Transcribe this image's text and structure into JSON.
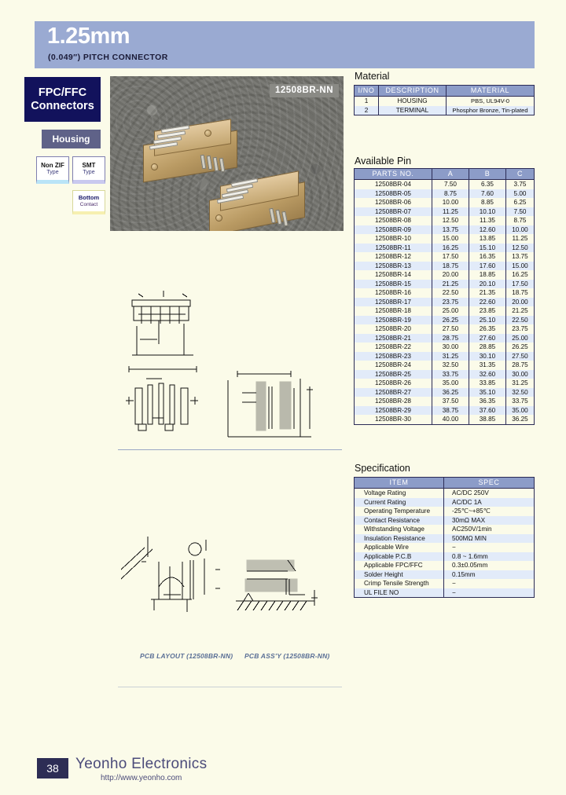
{
  "header": {
    "title": "1.25mm",
    "subtitle": "(0.049″)  PITCH  CONNECTOR"
  },
  "sidebar": {
    "family_line1": "FPC/FFC",
    "family_line2": "Connectors",
    "housing": "Housing",
    "type_nonzif_line1": "Non ZIF",
    "type_nonzif_line2": "Type",
    "type_smt_line1": "SMT",
    "type_smt_line2": "Type",
    "bottom_line1": "Bottom",
    "bottom_line2": "Contact"
  },
  "photo": {
    "label": "12508BR-NN"
  },
  "material": {
    "title": "Material",
    "columns": [
      "I/NO",
      "DESCRIPTION",
      "MATERIAL"
    ],
    "rows": [
      [
        "1",
        "HOUSING",
        "PBS, UL94V-0"
      ],
      [
        "2",
        "TERMINAL",
        "Phosphor Bronze, Tin-plated"
      ]
    ]
  },
  "available_pin": {
    "title": "Available Pin",
    "columns": [
      "PARTS NO.",
      "A",
      "B",
      "C"
    ],
    "rows": [
      [
        "12508BR-04",
        "7.50",
        "6.35",
        "3.75"
      ],
      [
        "12508BR-05",
        "8.75",
        "7.60",
        "5.00"
      ],
      [
        "12508BR-06",
        "10.00",
        "8.85",
        "6.25"
      ],
      [
        "12508BR-07",
        "11.25",
        "10.10",
        "7.50"
      ],
      [
        "12508BR-08",
        "12.50",
        "11.35",
        "8.75"
      ],
      [
        "12508BR-09",
        "13.75",
        "12.60",
        "10.00"
      ],
      [
        "12508BR-10",
        "15.00",
        "13.85",
        "11.25"
      ],
      [
        "12508BR-11",
        "16.25",
        "15.10",
        "12.50"
      ],
      [
        "12508BR-12",
        "17.50",
        "16.35",
        "13.75"
      ],
      [
        "12508BR-13",
        "18.75",
        "17.60",
        "15.00"
      ],
      [
        "12508BR-14",
        "20.00",
        "18.85",
        "16.25"
      ],
      [
        "12508BR-15",
        "21.25",
        "20.10",
        "17.50"
      ],
      [
        "12508BR-16",
        "22.50",
        "21.35",
        "18.75"
      ],
      [
        "12508BR-17",
        "23.75",
        "22.60",
        "20.00"
      ],
      [
        "12508BR-18",
        "25.00",
        "23.85",
        "21.25"
      ],
      [
        "12508BR-19",
        "26.25",
        "25.10",
        "22.50"
      ],
      [
        "12508BR-20",
        "27.50",
        "26.35",
        "23.75"
      ],
      [
        "12508BR-21",
        "28.75",
        "27.60",
        "25.00"
      ],
      [
        "12508BR-22",
        "30.00",
        "28.85",
        "26.25"
      ],
      [
        "12508BR-23",
        "31.25",
        "30.10",
        "27.50"
      ],
      [
        "12508BR-24",
        "32.50",
        "31.35",
        "28.75"
      ],
      [
        "12508BR-25",
        "33.75",
        "32.60",
        "30.00"
      ],
      [
        "12508BR-26",
        "35.00",
        "33.85",
        "31.25"
      ],
      [
        "12508BR-27",
        "36.25",
        "35.10",
        "32.50"
      ],
      [
        "12508BR-28",
        "37.50",
        "36.35",
        "33.75"
      ],
      [
        "12508BR-29",
        "38.75",
        "37.60",
        "35.00"
      ],
      [
        "12508BR-30",
        "40.00",
        "38.85",
        "36.25"
      ]
    ]
  },
  "specification": {
    "title": "Specification",
    "columns": [
      "ITEM",
      "SPEC"
    ],
    "rows": [
      [
        "Voltage Rating",
        "AC/DC 250V"
      ],
      [
        "Current Rating",
        "AC/DC 1A"
      ],
      [
        "Operating Temperature",
        "-25℃~+85℃"
      ],
      [
        "Contact Resistance",
        "30mΩ MAX"
      ],
      [
        "Withstanding Voltage",
        "AC250V/1min"
      ],
      [
        "Insulation Resistance",
        "500MΩ MIN"
      ],
      [
        "Applicable Wire",
        "−"
      ],
      [
        "Applicable P.C.B",
        "0.8 ~ 1.6mm"
      ],
      [
        "Applicable FPC/FFC",
        "0.3±0.05mm"
      ],
      [
        "Solder Height",
        "0.15mm"
      ],
      [
        "Crimp Tensile Strength",
        "−"
      ],
      [
        "UL FILE NO",
        "−"
      ]
    ]
  },
  "drawings": {
    "caption_layout": "PCB LAYOUT (12508BR-NN)",
    "caption_assy": "PCB ASS'Y (12508BR-NN)"
  },
  "footer": {
    "page": "38",
    "company": "Yeonho  Electronics",
    "url": "http://www.yeonho.com"
  }
}
